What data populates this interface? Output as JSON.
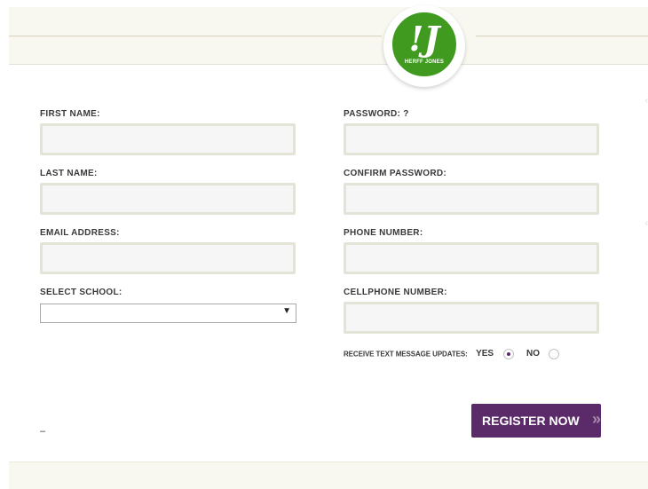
{
  "brand": {
    "logo_mark": "!J",
    "logo_text": "HERFF JONES"
  },
  "form": {
    "first_name_label": "FIRST NAME:",
    "last_name_label": "LAST NAME:",
    "email_label": "EMAIL ADDRESS:",
    "school_label": "SELECT SCHOOL:",
    "school_selected": "",
    "password_label": "PASSWORD: ?",
    "confirm_password_label": "CONFIRM PASSWORD:",
    "phone_label": "PHONE NUMBER:",
    "cellphone_label": "CELLPHONE NUMBER:",
    "sms_updates_label": "RECEIVE TEXT MESSAGE UPDATES:",
    "sms_yes_label": "YES",
    "sms_no_label": "NO",
    "sms_selected": "YES",
    "register_label": "REGISTER NOW",
    "register_chevrons": "»",
    "footer_dash": "–"
  },
  "icons": {
    "select_arrow": "caret-down-icon",
    "edge_arrows": "chevron-left-icon"
  },
  "colors": {
    "brand_green": "#3f9a1f",
    "button_purple": "#5b2a69",
    "header_band": "#f8f7f0"
  }
}
